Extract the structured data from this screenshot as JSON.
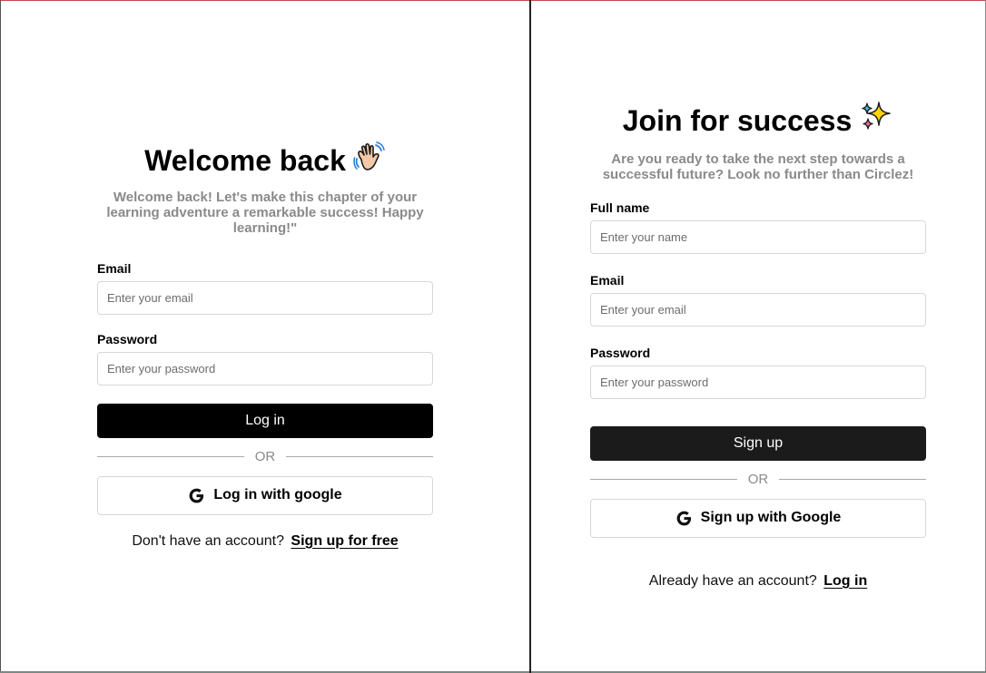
{
  "login": {
    "title": "Welcome back",
    "subtitle": "Welcome back! Let's make this chapter of your learning adventure a remarkable success! Happy learning!\"",
    "email_label": "Email",
    "email_placeholder": "Enter your email",
    "password_label": "Password",
    "password_placeholder": "Enter your password",
    "submit_label": "Log in",
    "or_text": "OR",
    "google_label": "Log in with google",
    "footer_text": "Don't have an account?",
    "footer_link": "Sign up for free"
  },
  "signup": {
    "title": "Join for success",
    "subtitle": "Are you ready to take the next step towards a successful future? Look no further than Circlez!",
    "name_label": "Full name",
    "name_placeholder": "Enter your name",
    "email_label": "Email",
    "email_placeholder": "Enter your email",
    "password_label": "Password",
    "password_placeholder": "Enter your password",
    "submit_label": "Sign up",
    "or_text": "OR",
    "google_label": "Sign up with Google",
    "footer_text": "Already have an account?",
    "footer_link": "Log in"
  },
  "icons": {
    "login_title_icon": "waving-hand-icon",
    "signup_title_icon": "sparkles-icon",
    "google_icon": "google-g-icon"
  },
  "colors": {
    "primary_button": "#000000",
    "secondary_text": "#8a8a8a",
    "input_border": "#d7d7d7"
  }
}
